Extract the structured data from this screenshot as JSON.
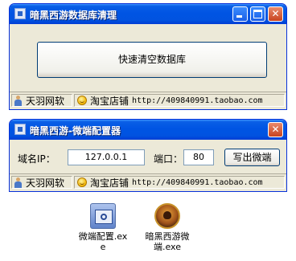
{
  "window1": {
    "title": "暗黑西游数据库清理",
    "clear_button": "快速清空数据库",
    "status": {
      "author": "天羽网软",
      "shop_label": "淘宝店铺",
      "shop_url": "http://409840991.taobao.com"
    }
  },
  "window2": {
    "title": "暗黑西游-微端配置器",
    "domain_label": "域名IP：",
    "domain_value": "127.0.0.1",
    "port_label": "端口：",
    "port_value": "80",
    "write_button": "写出微端",
    "status": {
      "author": "天羽网软",
      "shop_label": "淘宝店铺",
      "shop_url": "http://409840991.taobao.com"
    }
  },
  "desktop": {
    "icons": [
      {
        "label": "微端配置.exe",
        "icon": "config-app-icon"
      },
      {
        "label": "暗黑西游微端.exe",
        "icon": "game-app-icon"
      }
    ]
  }
}
